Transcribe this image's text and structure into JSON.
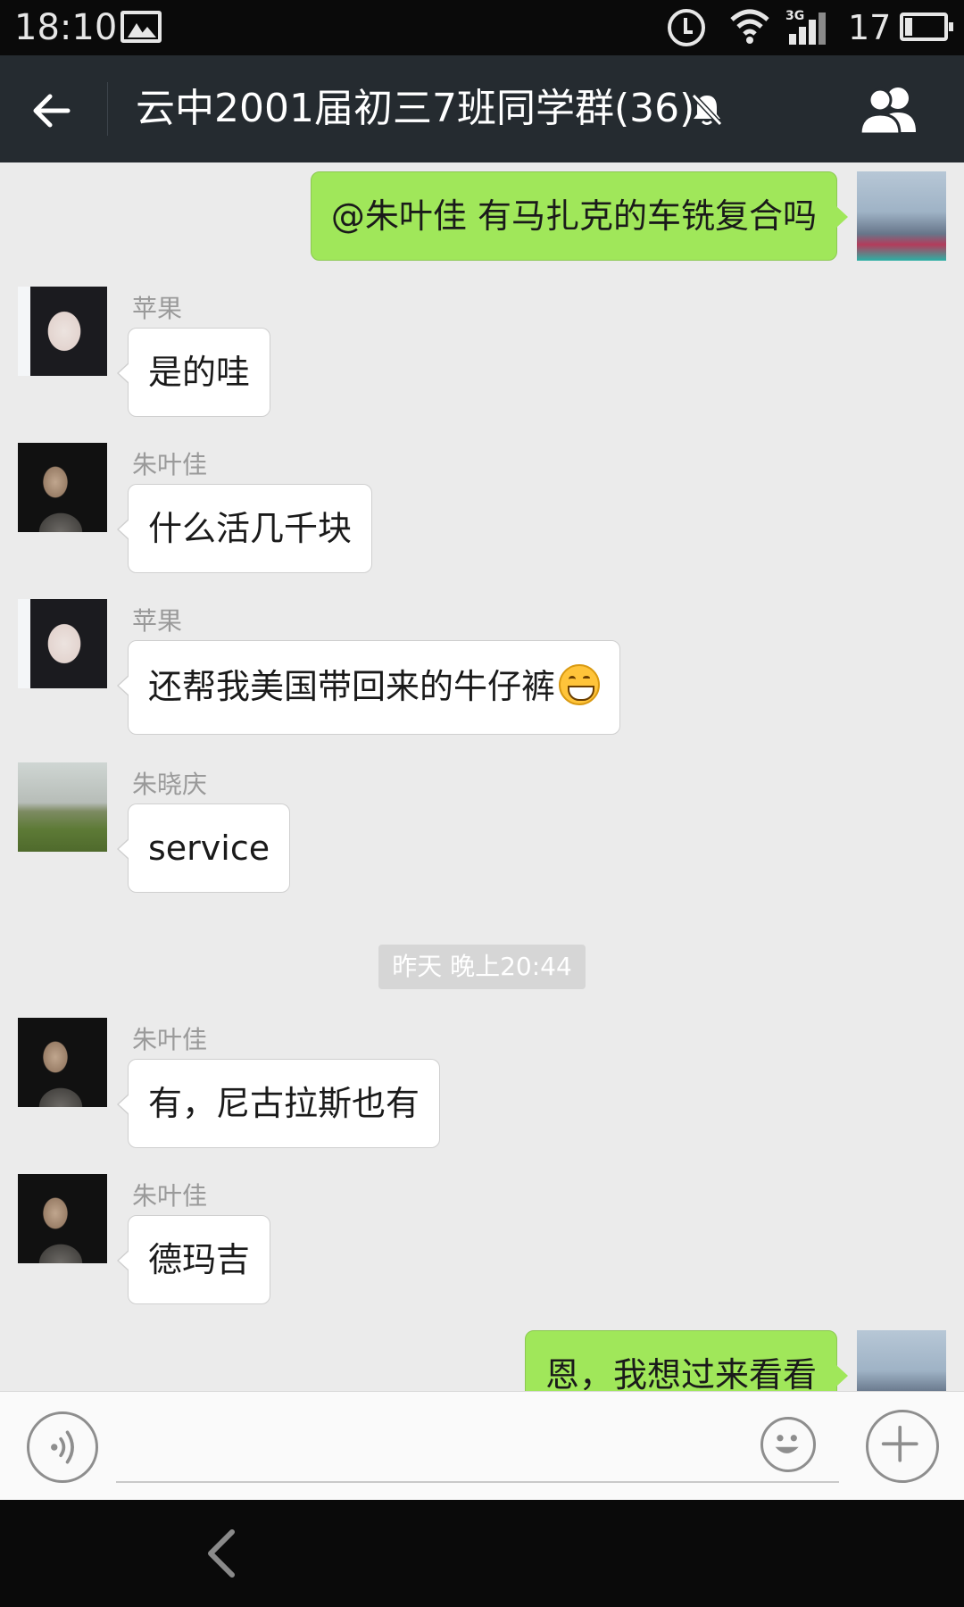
{
  "status_bar": {
    "time": "18:10",
    "network_type": "3G",
    "battery_level": "17"
  },
  "header": {
    "title": "云中2001届初三7班同学群(36)",
    "back_icon": "arrow-left-icon",
    "mute_icon": "bell-off-icon",
    "members_icon": "group-icon"
  },
  "messages": [
    {
      "direction": "out",
      "text": "@朱叶佳 有马扎克的车铣复合吗"
    },
    {
      "direction": "in",
      "sender": "苹果",
      "text": "是的哇"
    },
    {
      "direction": "in",
      "sender": "朱叶佳",
      "text": "什么活几千块"
    },
    {
      "direction": "in",
      "sender": "苹果",
      "text": "还帮我美国带回来的牛仔裤",
      "emoji": "grinning-face-emoji"
    },
    {
      "direction": "in",
      "sender": "朱晓庆",
      "text": "service"
    },
    {
      "direction": "in",
      "sender": "朱叶佳",
      "text": "有，尼古拉斯也有"
    },
    {
      "direction": "in",
      "sender": "朱叶佳",
      "text": "德玛吉"
    },
    {
      "direction": "out",
      "text": "恩，我想过来看看"
    }
  ],
  "time_divider": "昨天 晚上20:44",
  "input_bar": {
    "voice_icon": "voice-icon",
    "emoji_icon": "smiley-icon",
    "plus_icon": "plus-icon"
  },
  "colors": {
    "header_bg": "#252b30",
    "chat_bg": "#ebebeb",
    "outgoing_bubble": "#a0e75a",
    "incoming_bubble": "#ffffff"
  }
}
